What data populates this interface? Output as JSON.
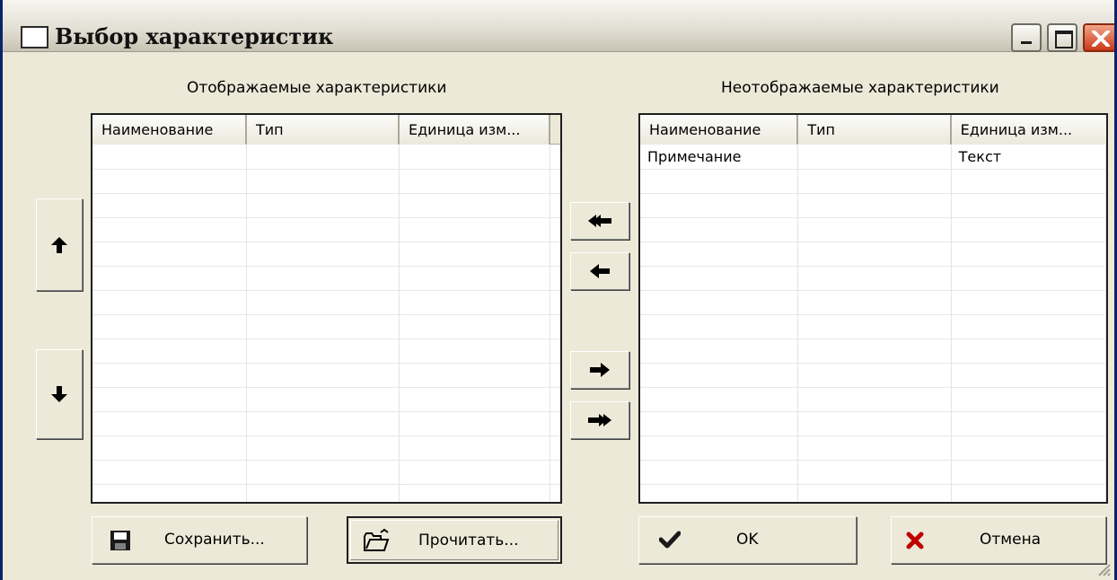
{
  "window": {
    "title": "Выбор характеристик"
  },
  "left_panel": {
    "caption": "Отображаемые характеристики",
    "columns": [
      "Наименование",
      "Тип",
      "Единица изм..."
    ],
    "rows": []
  },
  "right_panel": {
    "caption": "Неотображаемые характеристики",
    "columns": [
      "Наименование",
      "Тип",
      "Единица изм..."
    ],
    "rows": [
      [
        "Примечание",
        "",
        "Текст"
      ]
    ]
  },
  "buttons": {
    "save_label": "Сохранить...",
    "load_label": "Прочитать...",
    "ok_label": "OK",
    "cancel_label": "Отмена"
  },
  "icons": {
    "move_up": "arrow-up-icon",
    "move_down": "arrow-down-icon",
    "move_all_left": "double-arrow-left-icon",
    "move_left": "arrow-left-icon",
    "move_right": "arrow-right-icon",
    "move_all_right": "double-arrow-right-icon",
    "save": "floppy-disk-icon",
    "load": "open-folder-icon",
    "ok": "checkmark-icon",
    "cancel": "red-x-icon"
  },
  "colors": {
    "titlebar_border": "#0a246a",
    "window_bg": "#ece9d8",
    "cancel_icon": "#c00000"
  }
}
